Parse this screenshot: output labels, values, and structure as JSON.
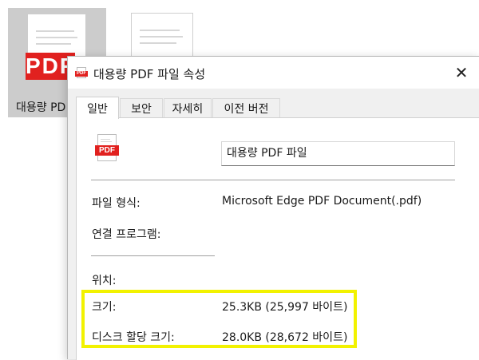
{
  "desktop": {
    "icons": [
      {
        "label": "대용량 PD",
        "badge": "PDF"
      },
      {
        "label": "",
        "badge": ""
      }
    ]
  },
  "dialog": {
    "title": "대용량 PDF 파일 속성",
    "close_glyph": "✕",
    "title_icon_badge": "PDF",
    "tabs": [
      "일반",
      "보안",
      "자세히",
      "이전 버전"
    ],
    "active_tab": "일반",
    "file_icon_badge": "PDF",
    "file_name": "대용량 PDF 파일",
    "rows": {
      "type_label": "파일 형식:",
      "type_value": "Microsoft Edge PDF Document(.pdf)",
      "program_label": "연결 프로그램:",
      "location_label": "위치:",
      "size_label": "크기:",
      "size_value": "25.3KB (25,997 바이트)",
      "disk_label": "디스크 할당 크기:",
      "disk_value": "28.0KB (28,672 바이트)"
    }
  },
  "colors": {
    "highlight": "#f2f200",
    "pdf_red": "#e1211f",
    "selected_icon_bg": "#cccccc"
  }
}
